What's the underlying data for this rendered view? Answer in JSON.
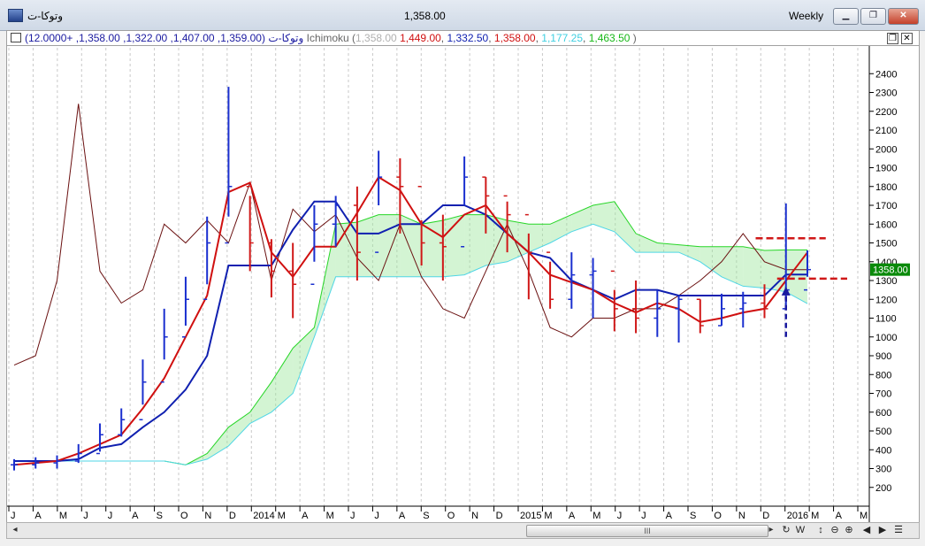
{
  "window": {
    "title": "وتوکا-ت",
    "price": "1,358.00",
    "period": "Weekly",
    "minimize_label": "▁",
    "restore_label": "❐",
    "close_label": "✕"
  },
  "legend": {
    "symbol": "وتوکا-ت",
    "ohlc": "(1,359.00, 1,407.00, 1,322.00, 1,358.00, +12.0000)",
    "indicator": "Ichimoku (",
    "v1": "1,358.00",
    "v2": "1,449.00",
    "v3": "1,332.50",
    "v4": "1,358.00",
    "v5": "1,177.25",
    "v6": "1,463.50",
    "close_paren": ")",
    "restore_label": "❐",
    "close_label": "✕"
  },
  "colors": {
    "up_bar": "#1a2fcf",
    "down_bar": "#d01818",
    "tenkan": "#d01010",
    "kijun": "#1020b0",
    "chikou": "#6a1010",
    "senkou_a": "#27d627",
    "senkou_b": "#4fd6e6",
    "v1_color": "#b0b0b0",
    "v2_color": "#d01010",
    "v3_color": "#1020b0",
    "v4_color": "#d01010",
    "v5_color": "#3fcfe0",
    "v6_color": "#18b818"
  },
  "chart_data": {
    "type": "ichimoku-ohlc",
    "period": "Weekly",
    "y_ticks": [
      200,
      300,
      400,
      500,
      600,
      700,
      800,
      900,
      1000,
      1100,
      1200,
      1300,
      1400,
      1500,
      1600,
      1700,
      1800,
      1900,
      2000,
      2100,
      2200,
      2300,
      2400
    ],
    "ylim": [
      100,
      2500
    ],
    "last_price_label": "1358.00",
    "x_labels": [
      "J",
      "A",
      "M",
      "J",
      "J",
      "A",
      "S",
      "O",
      "N",
      "D",
      "2014",
      "M",
      "A",
      "M",
      "J",
      "J",
      "A",
      "S",
      "O",
      "N",
      "D",
      "2015",
      "M",
      "A",
      "M",
      "J",
      "J",
      "A",
      "S",
      "O",
      "N",
      "D",
      "2016",
      "M",
      "A",
      "M"
    ],
    "price_x": [
      "2013-02",
      "2013-03",
      "2013-04",
      "2013-05",
      "2013-06",
      "2013-07",
      "2013-08",
      "2013-09",
      "2013-10",
      "2013-11",
      "2013-12",
      "2014-01",
      "2014-02",
      "2014-03",
      "2014-04",
      "2014-05",
      "2014-06",
      "2014-07",
      "2014-08",
      "2014-09",
      "2014-10",
      "2014-11",
      "2014-12",
      "2015-01",
      "2015-02",
      "2015-03",
      "2015-04",
      "2015-05",
      "2015-06",
      "2015-07",
      "2015-08",
      "2015-09",
      "2015-10",
      "2015-11",
      "2015-12",
      "2016-01",
      "2016-02",
      "2016-03"
    ],
    "close": [
      320,
      330,
      340,
      380,
      480,
      560,
      760,
      1000,
      1200,
      1500,
      1800,
      1500,
      1350,
      1280,
      1600,
      1700,
      1450,
      1850,
      1800,
      1500,
      1480,
      1850,
      1750,
      1650,
      1450,
      1200,
      1330,
      1350,
      1150,
      1100,
      1150,
      1200,
      1060,
      1150,
      1180,
      1150,
      1250,
      1358
    ],
    "high": [
      350,
      360,
      370,
      430,
      540,
      620,
      880,
      1150,
      1320,
      1640,
      2330,
      1750,
      1520,
      1500,
      1700,
      1750,
      1800,
      1990,
      1950,
      1620,
      1650,
      1960,
      1850,
      1720,
      1550,
      1400,
      1450,
      1420,
      1250,
      1300,
      1250,
      1220,
      1200,
      1230,
      1240,
      1280,
      1710,
      1460
    ],
    "low": [
      290,
      300,
      300,
      330,
      390,
      470,
      640,
      880,
      1060,
      1280,
      1640,
      1350,
      1210,
      1100,
      1400,
      1480,
      1300,
      1700,
      1550,
      1380,
      1300,
      1700,
      1550,
      1450,
      1200,
      1150,
      1150,
      1100,
      1030,
      1020,
      1000,
      970,
      1020,
      1060,
      1050,
      1100,
      1150,
      1320
    ],
    "series": [
      {
        "name": "Tenkan",
        "values": [
          320,
          330,
          340,
          380,
          430,
          480,
          620,
          780,
          1000,
          1220,
          1770,
          1820,
          1450,
          1320,
          1480,
          1480,
          1660,
          1850,
          1780,
          1600,
          1530,
          1650,
          1700,
          1550,
          1450,
          1330,
          1290,
          1250,
          1180,
          1130,
          1180,
          1150,
          1080,
          1100,
          1130,
          1150,
          1300,
          1449
        ]
      },
      {
        "name": "Kijun",
        "values": [
          340,
          340,
          340,
          350,
          410,
          430,
          520,
          600,
          720,
          900,
          1380,
          1380,
          1380,
          1570,
          1720,
          1720,
          1550,
          1550,
          1600,
          1600,
          1700,
          1700,
          1650,
          1550,
          1450,
          1420,
          1300,
          1250,
          1200,
          1250,
          1250,
          1220,
          1220,
          1220,
          1220,
          1220,
          1332,
          1332
        ]
      },
      {
        "name": "Chikou",
        "values": [
          850,
          900,
          1300,
          2240,
          1350,
          1180,
          1250,
          1600,
          1500,
          1620,
          1500,
          1820,
          1300,
          1680,
          1560,
          1650,
          1420,
          1300,
          1600,
          1320,
          1150,
          1100,
          1350,
          1600,
          1350,
          1050,
          1000,
          1100,
          1100,
          1150,
          1150,
          1220,
          1300,
          1400,
          1550,
          1400,
          1358,
          1358
        ]
      },
      {
        "name": "Senkou A",
        "values": [
          340,
          340,
          340,
          340,
          340,
          340,
          340,
          340,
          320,
          380,
          520,
          600,
          760,
          940,
          1050,
          1600,
          1610,
          1650,
          1650,
          1600,
          1620,
          1650,
          1650,
          1620,
          1600,
          1600,
          1650,
          1700,
          1720,
          1550,
          1500,
          1490,
          1480,
          1480,
          1480,
          1460,
          1463,
          1463
        ]
      },
      {
        "name": "Senkou B",
        "values": [
          340,
          340,
          340,
          340,
          340,
          340,
          340,
          340,
          320,
          350,
          420,
          540,
          600,
          700,
          1000,
          1320,
          1320,
          1320,
          1320,
          1320,
          1320,
          1330,
          1380,
          1400,
          1450,
          1500,
          1560,
          1600,
          1560,
          1450,
          1450,
          1450,
          1400,
          1320,
          1270,
          1260,
          1240,
          1177
        ]
      }
    ],
    "annotations": [
      {
        "type": "hline-dashed",
        "value": 1525,
        "from": "2016-01",
        "to": "2016-02"
      },
      {
        "type": "hline-dashed",
        "value": 1310,
        "from": "2016-02",
        "to": "2016-03"
      },
      {
        "type": "arrow-up-dashed",
        "x": "2016-02",
        "from": 1000,
        "to": 1230
      }
    ]
  },
  "scrollbar": {
    "left_label": "◂",
    "right_label": "▸",
    "thumb_grip": "III"
  },
  "toolbar": [
    "↻",
    "W",
    "↕",
    "⊖",
    "⊕",
    "◀",
    "▶",
    "☰"
  ]
}
